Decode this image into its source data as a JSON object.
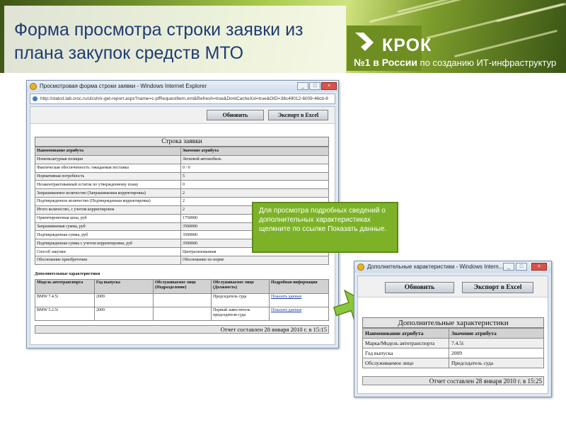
{
  "slide": {
    "title": "Форма просмотра строки заявки из плана закупок средств МТО",
    "logo_text": "КРОК",
    "tagline_bold": "№1 в России",
    "tagline_rest": " по созданию ИТ-инфраструктур"
  },
  "window1": {
    "title": "Просмотровая форма строки заявки - Windows Internet Explorer",
    "address": "http://statcd.lab.croc.ru/ulcsh/x-get-report.aspx?name=c-pfRequestItem.xml&Refresh=true&DontCacheXsl=true&OID=38c49012-6009-46cb-8",
    "buttons": {
      "refresh": "Обновить",
      "export": "Экспорт в Excel"
    },
    "form_title": "Строка заявки",
    "columns": [
      "Наименование атрибута",
      "Значение атрибута"
    ],
    "rows": [
      [
        "Номенклатурная позиция",
        "Легковой автомобиль"
      ],
      [
        "Фактическая обеспеченность /ожидаемая поставка",
        "0 / 0"
      ],
      [
        "Нормативная потребность",
        "5"
      ],
      [
        "Незаконтрактованный остаток по утвержденному плану",
        "0"
      ],
      [
        "Запрашиваемое количество (Запрашиваемая корректировка)",
        "2"
      ],
      [
        "Подтвержденное количество (Подтвержденная корректировка)",
        "2"
      ],
      [
        "Итого количество, с учетом корректировок",
        "2"
      ],
      [
        "Ориентировочная цена, руб",
        "1750000"
      ],
      [
        "Запрашиваемая сумма, руб",
        "3500000"
      ],
      [
        "Подтвержденная сумма, руб",
        "3500000"
      ],
      [
        "Подтвержденная сумма с учетом корректировки, руб",
        "3500000"
      ],
      [
        "Способ закупки",
        "Централизованная"
      ],
      [
        "Обоснование приобретения",
        "Обоснование по норме"
      ]
    ],
    "ext_label": "Дополнительные характеристики",
    "ext_columns": [
      "Модель автотранспорта",
      "Год выпуска",
      "Обслуживаемое лицо (Подразделение)",
      "Обслуживаемое лицо (Должность)",
      "Подробная информация"
    ],
    "ext_rows": [
      {
        "model": "BMW 7.4.5i",
        "year": "2009",
        "unit": "",
        "position": "Председатель суда",
        "link": "Показать данные"
      },
      {
        "model": "BMW 5.2.5i",
        "year": "2009",
        "unit": "",
        "position": "Первый заместитель председателя суда",
        "link": "Показать данные"
      }
    ],
    "footer": "Отчет составлен 28 января 2010 г. в 15:15"
  },
  "callout": {
    "text": "Для просмотра подробных сведений о дополнительных характеристиках щелкните по ссылке Показать данные."
  },
  "window2": {
    "title": "Дополнительные характеристики - Windows Intern...",
    "buttons": {
      "refresh": "Обновить",
      "export": "Экспорт в Excel"
    },
    "form_title": "Дополнительные характеристики",
    "columns": [
      "Наименование атрибута",
      "Значение атрибута"
    ],
    "rows": [
      [
        "Марка/Модель автотранспорта",
        "7.4.5i"
      ],
      [
        "Год выпуска",
        "2009"
      ],
      [
        "Обслуживаемое лицо",
        "Председатель суда"
      ]
    ],
    "footer": "Отчет составлен 28 января 2010 г. в 15:25"
  },
  "colors": {
    "accent_green": "#7db228",
    "title_blue": "#1f3c72",
    "link_blue": "#1a3bb0"
  }
}
